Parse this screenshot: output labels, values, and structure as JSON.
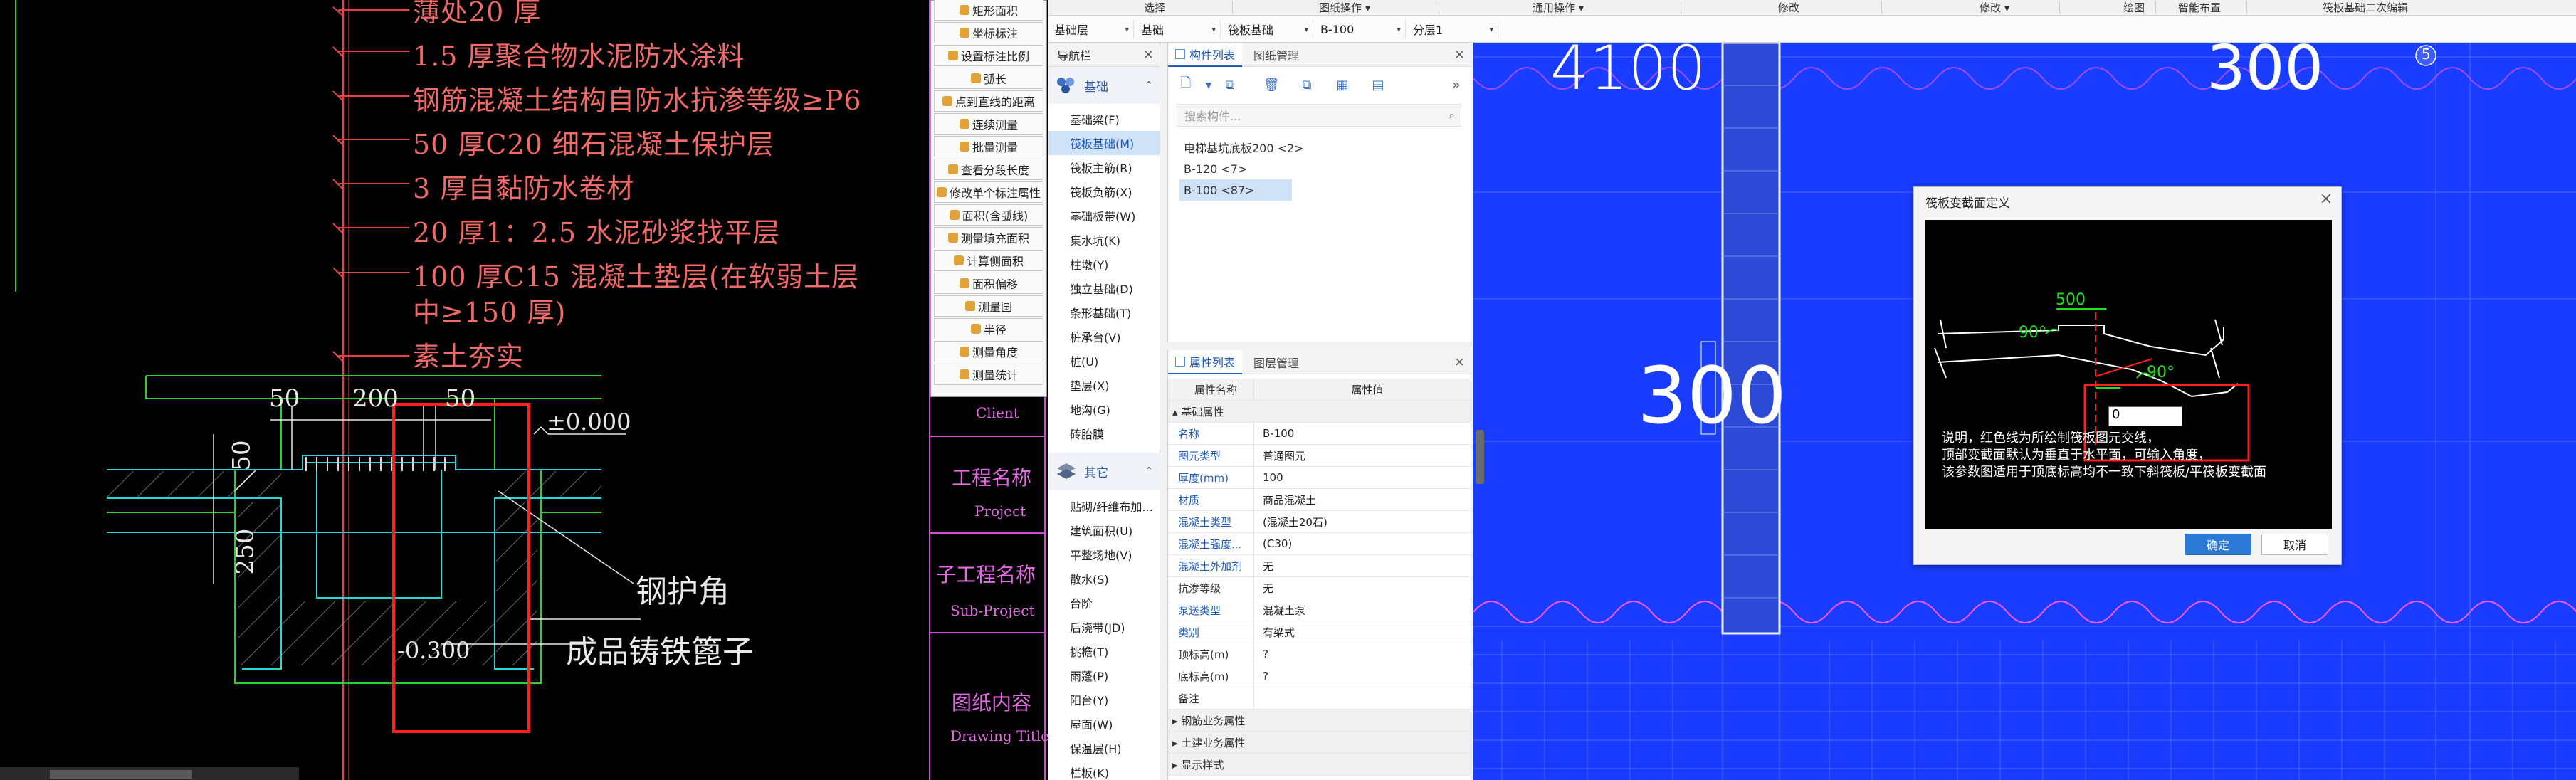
{
  "cad_notes": [
    "薄处20 厚",
    "1.5 厚聚合物水泥防水涂料",
    "钢筋混凝土结构自防水抗渗等级≥P6",
    "50 厚C20 细石混凝土保护层",
    "3 厚自黏防水卷材",
    "20 厚1：2.5 水泥砂浆找平层",
    "100 厚C15 混凝土垫层(在软弱土层",
    "中≥150 厚)",
    "素土夯实"
  ],
  "cad_dims": {
    "d50a": "50",
    "d200": "200",
    "d50b": "50",
    "dv50": "50",
    "dv250": "250"
  },
  "cad_labels": {
    "angle_guard": "钢护角",
    "grate": "成品铸铁篦子",
    "elev_top": "±0.000",
    "elev_bottom": "-0.300"
  },
  "title_block": [
    {
      "cn": "Client",
      "en": ""
    },
    {
      "cn": "工程名称",
      "en": "Project"
    },
    {
      "cn": "子工程名称",
      "en": "Sub-Project"
    },
    {
      "cn": "图纸内容",
      "en": "Drawing Title"
    }
  ],
  "measure_menu": [
    "矩形面积",
    "坐标标注",
    "设置标注比例",
    "弧长",
    "点到直线的距离",
    "连续测量",
    "批量测量",
    "查看分段长度",
    "修改单个标注属性",
    "面积(含弧线)",
    "测量填充面积",
    "计算侧面积",
    "面积偏移",
    "测量圆",
    "半径",
    "测量角度",
    "测量统计"
  ],
  "ribbon": {
    "groups": [
      "选择",
      "图纸操作 ▾",
      "通用操作 ▾",
      "修改",
      "修改 ▾",
      "绘图",
      "智能布置",
      "筏板基础二次编辑"
    ]
  },
  "toolbar": {
    "floor": "基础层",
    "category": "基础",
    "type": "筏板基础",
    "component": "B-100",
    "layer": "分层1"
  },
  "nav_panel": {
    "title": "导航栏",
    "group_foundation": "基础",
    "items": [
      "基础梁(F)",
      "筏板基础(M)",
      "筏板主筋(R)",
      "筏板负筋(X)",
      "基础板带(W)",
      "集水坑(K)",
      "柱墩(Y)",
      "独立基础(D)",
      "条形基础(T)",
      "桩承台(V)",
      "桩(U)",
      "垫层(X)",
      "地沟(G)",
      "砖胎膜"
    ],
    "selected_index": 1,
    "group_other": "其它",
    "other_items": [
      "贴砌/纤维布加...",
      "建筑面积(U)",
      "平整场地(V)",
      "散水(S)",
      "台阶",
      "后浇带(JD)",
      "挑檐(T)",
      "雨蓬(P)",
      "阳台(Y)",
      "屋面(W)",
      "保温层(H)",
      "栏板(K)"
    ]
  },
  "comp_panel": {
    "tab_active": "构件列表",
    "tab_inactive": "图纸管理",
    "search_placeholder": "搜索构件...",
    "items": [
      "电梯基坑底板200 <2>",
      "B-120 <7>",
      "B-100 <87>"
    ],
    "selected_index": 2
  },
  "prop_panel": {
    "tab_active": "属性列表",
    "tab_inactive": "图层管理",
    "col_name": "属性名称",
    "col_value": "属性值",
    "section_basic": "基础属性",
    "rows": [
      {
        "name": "名称",
        "value": "B-100",
        "blue": true
      },
      {
        "name": "图元类型",
        "value": "普通图元",
        "blue": true
      },
      {
        "name": "厚度(mm)",
        "value": "100",
        "blue": true
      },
      {
        "name": "材质",
        "value": "商品混凝土",
        "blue": true
      },
      {
        "name": "混凝土类型",
        "value": "(混凝土20石)",
        "blue": true
      },
      {
        "name": "混凝土强度...",
        "value": "(C30)",
        "blue": true
      },
      {
        "name": "混凝土外加剂",
        "value": "无",
        "blue": true
      },
      {
        "name": "抗渗等级",
        "value": "无",
        "blue": false
      },
      {
        "name": "泵送类型",
        "value": "混凝土泵",
        "blue": true
      },
      {
        "name": "类别",
        "value": "有梁式",
        "blue": true
      },
      {
        "name": "顶标高(m)",
        "value": "?",
        "blue": false
      },
      {
        "name": "底标高(m)",
        "value": "?",
        "blue": false
      },
      {
        "name": "备注",
        "value": "",
        "blue": false
      }
    ],
    "sections_collapsed": [
      "钢筋业务属性",
      "土建业务属性",
      "显示样式"
    ]
  },
  "canvas": {
    "labels": {
      "t4100": "4100",
      "t300a": "300",
      "t300b": "300",
      "axis5": "5"
    }
  },
  "dialog": {
    "title": "筏板变截面定义",
    "dim500": "500",
    "ang90a": "90°",
    "ang90b": "90°",
    "input_value": "0",
    "desc": [
      "说明，红色线为所绘制筏板图元交线，",
      "顶部变截面默认为垂直于水平面，可输入角度，",
      "该参数图适用于顶底标高均不一致下斜筏板/平筏板变截面"
    ],
    "ok": "确定",
    "cancel": "取消"
  }
}
